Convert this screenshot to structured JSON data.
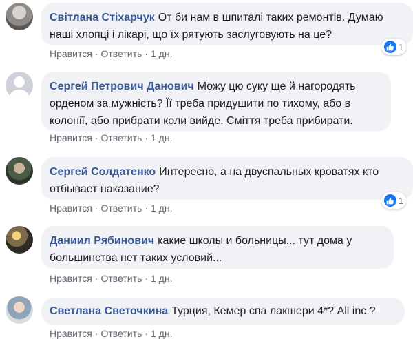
{
  "actions": {
    "like": "Нравится",
    "reply": "Ответить",
    "time": "1 дн."
  },
  "comments": [
    {
      "author": "Світлана Стіхарчук",
      "text": "От би нам в шпиталі таких ремонтів. Думаю наші хлопці і лікарі, що їх рятують заслуговують на це?",
      "reactions": "1"
    },
    {
      "author": "Сергей Петрович Данович",
      "text": "Можу цю суку ще й нагородять орденом за мужність? Її треба придушити по тихому, або в колонії, або прибрати коли вийде. Сміття треба прибирати."
    },
    {
      "author": "Сергей Солдатенко",
      "text": "Интересно, а на двуспальных кроватях кто отбывает наказание?",
      "reactions": "1"
    },
    {
      "author": "Даниил Рябинович",
      "text": "какие школы и больницы... тут дома у большинства нет таких условий..."
    },
    {
      "author": "Светлана Светочкина",
      "text": "Турция, Кемер спа лакшери 4*? All inc.?"
    }
  ]
}
